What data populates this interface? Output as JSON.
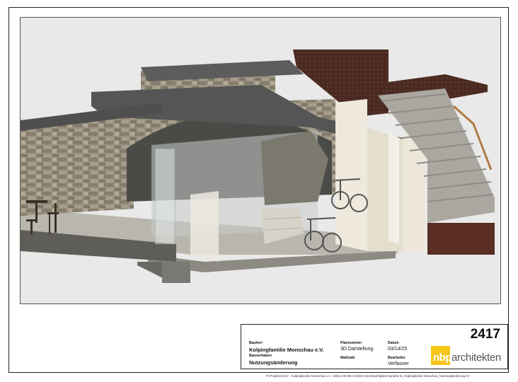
{
  "title_block": {
    "project_number": "2417",
    "client_label": "Bauherr",
    "client": "Kolpingfamilie Monschau e.V.",
    "project_label": "Bauvorhaben",
    "project": "Nutzungsänderung",
    "plan_number_label": "Plannummer",
    "plan_type": "3D Darstellung",
    "scale_label": "Maßstab",
    "date_label": "Datum",
    "date": "03/14/25",
    "author_label": "Bearbeiter",
    "author": "Verfasser",
    "logo_mark": "nbp",
    "logo_text": "architekten"
  },
  "footer": {
    "file_path": "P:\\Projekte\\2417 - Kolpingfamilie Monschau e.V - Dritte Ortn\\05 CAD\\04 Vorentwurfspläne\\Variante B_Kolpingfamilie Monschau_Nutzungsänderung.rvt"
  },
  "colors": {
    "logo_yellow": "#f5c518",
    "roof_brown": "#4a2a20",
    "slab_dark": "#5b5b5b",
    "wall_cream": "#eee9dc",
    "stone": "#8a8272"
  }
}
